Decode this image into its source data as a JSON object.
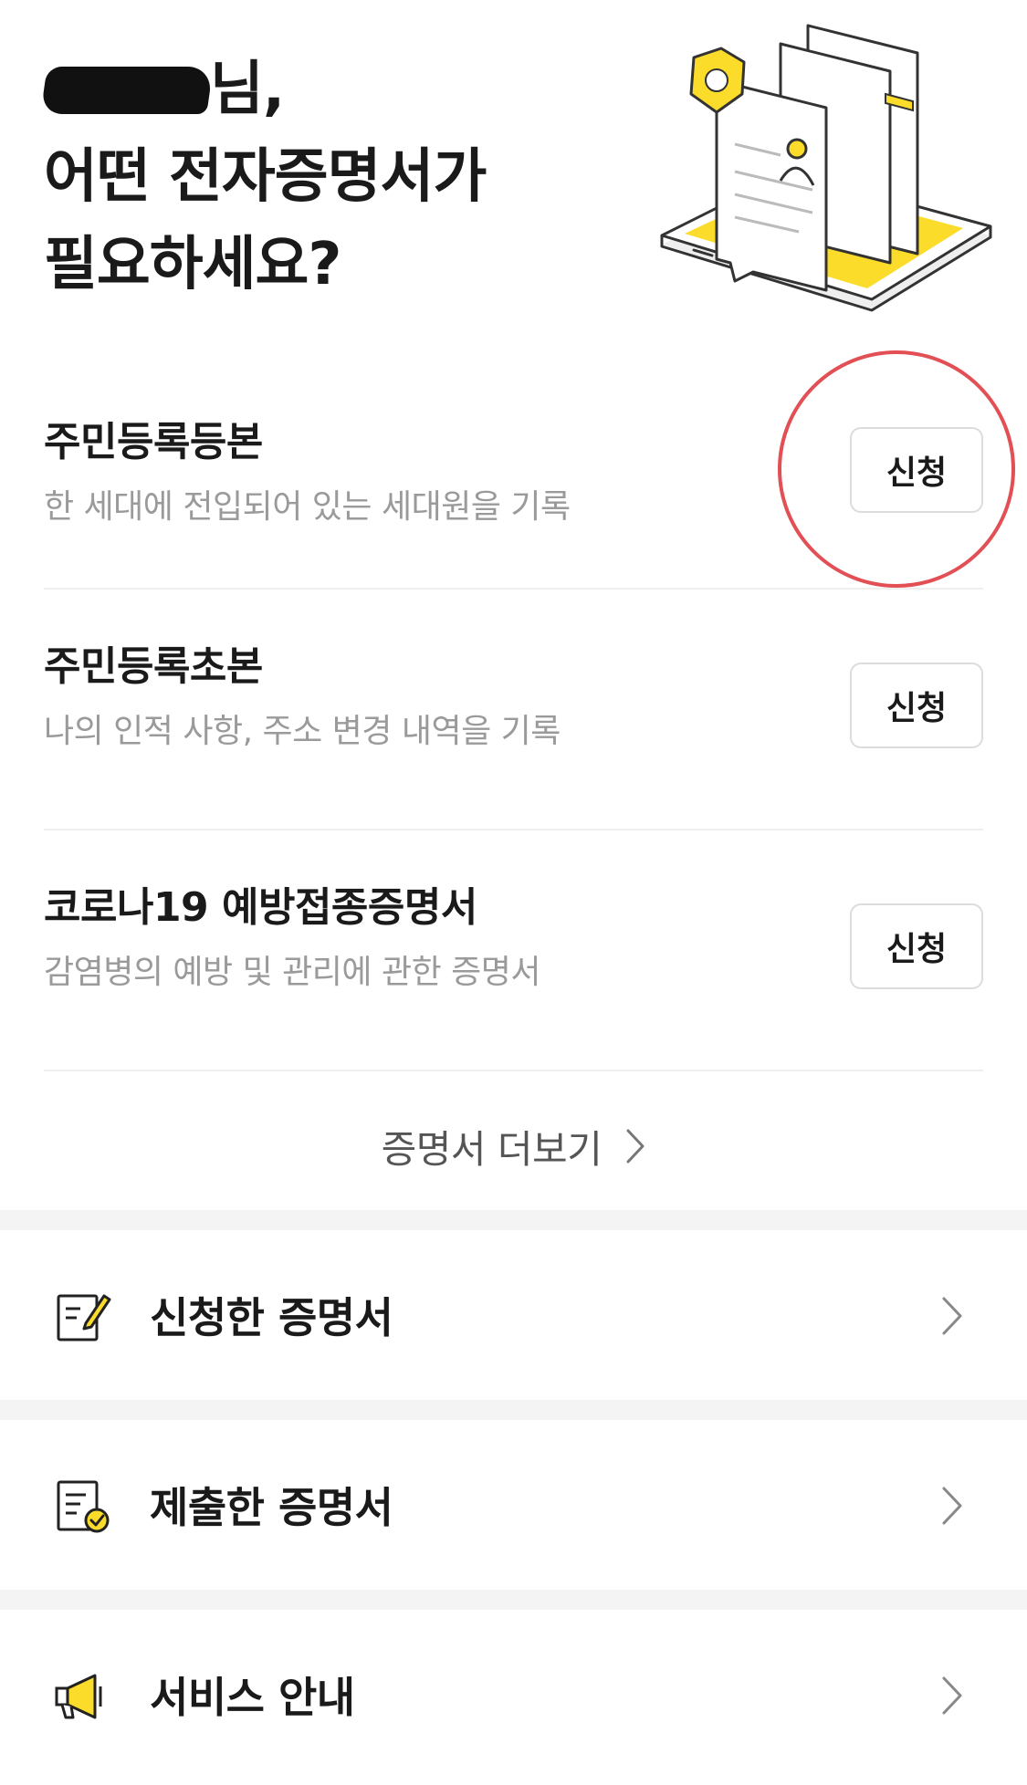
{
  "header": {
    "greeting_suffix": "님,",
    "line2": "어떤 전자증명서가",
    "line3": "필요하세요?"
  },
  "certificates": [
    {
      "title": "주민등록등본",
      "description": "한 세대에 전입되어 있는 세대원을 기록",
      "button": "신청"
    },
    {
      "title": "주민등록초본",
      "description": "나의 인적 사항, 주소 변경 내역을 기록",
      "button": "신청"
    },
    {
      "title": "코로나19 예방접종증명서",
      "description": "감염병의 예방 및 관리에 관한 증명서",
      "button": "신청"
    }
  ],
  "more": {
    "label": "증명서 더보기"
  },
  "menu": [
    {
      "label": "신청한 증명서",
      "icon": "edit-document-icon"
    },
    {
      "label": "제출한 증명서",
      "icon": "submitted-document-icon"
    },
    {
      "label": "서비스 안내",
      "icon": "megaphone-icon"
    }
  ],
  "colors": {
    "accent_yellow": "#fee500",
    "annotation_red": "#e24f55",
    "description_gray": "#9a9a9a",
    "divider": "#efefef"
  }
}
